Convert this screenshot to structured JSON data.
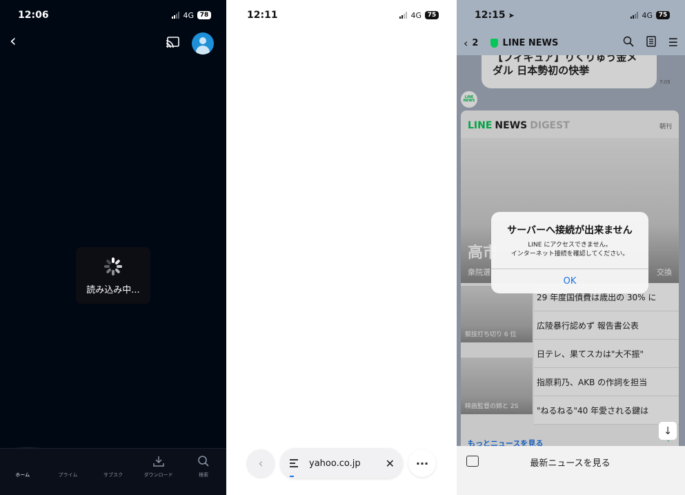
{
  "panel1": {
    "status": {
      "time": "12:06",
      "network": "4G",
      "battery": "78"
    },
    "loading_text": "読み込み中...",
    "tabs": [
      {
        "label": "ホーム",
        "icon": "home-icon"
      },
      {
        "label": "プライム",
        "icon": "prime-icon"
      },
      {
        "label": "サブスク",
        "icon": "subscription-icon"
      },
      {
        "label": "ダウンロード",
        "icon": "download-icon"
      },
      {
        "label": "検索",
        "icon": "search-icon"
      }
    ]
  },
  "panel2": {
    "status": {
      "time": "12:11",
      "network": "4G",
      "battery": "75"
    },
    "url": "yahoo.co.jp"
  },
  "panel3": {
    "status": {
      "time": "12:15",
      "network": "4G",
      "battery": "75"
    },
    "nav": {
      "back_count": "2",
      "title": "LINE NEWS"
    },
    "bubble": {
      "line1": "【フィギュア】りくりゅう金メ",
      "line2": "ダル 日本勢初の快挙",
      "time": "7:05"
    },
    "digest": {
      "brand_line": "LINE",
      "brand_news": "NEWS",
      "brand_digest": "DIGEST",
      "edition": "朝刊",
      "hero_title": "高市",
      "hero_sub": "衆院選",
      "hero_sub_right": "交換",
      "items": [
        "29 年度国債費は歳出の 30% に",
        "広陵暴行認めず 報告書公表",
        "日テレ、果てスカは\"大不振\"",
        "指原莉乃、AKB の作詞を担当",
        "\"ねるねる\"40 年愛される鍵は"
      ],
      "thumb_captions": [
        "競技打ち切り 6 位",
        "映画監督の姉と 2S"
      ],
      "more_label": "もっとニュースを見る"
    },
    "bottom_label": "最新ニュースを見る",
    "alert": {
      "title": "サーバーへ接続が出来ません",
      "msg1": "LINE にアクセスできません。",
      "msg2": "インターネット接続を確認してください。",
      "ok": "OK"
    }
  }
}
